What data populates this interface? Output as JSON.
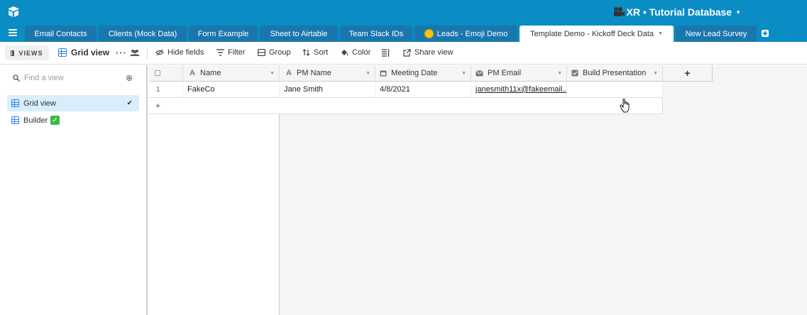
{
  "app": {
    "base_title": "XR • Tutorial Database"
  },
  "tabs": [
    {
      "label": "Email Contacts"
    },
    {
      "label": "Clients (Mock Data)"
    },
    {
      "label": "Form Example"
    },
    {
      "label": "Sheet to Airtable"
    },
    {
      "label": "Team Slack IDs"
    },
    {
      "label": "Leads - Emoji Demo"
    },
    {
      "label": "Template Demo - Kickoff Deck Data"
    },
    {
      "label": "New Lead Survey"
    }
  ],
  "toolbar": {
    "views_label": "VIEWS",
    "current_view": "Grid view",
    "more": "···",
    "hide_fields": "Hide fields",
    "filter": "Filter",
    "group": "Group",
    "sort": "Sort",
    "color": "Color",
    "share_view": "Share view"
  },
  "sidebar": {
    "find_placeholder": "Find a view",
    "views": [
      {
        "label": "Grid view",
        "selected": true,
        "check": "✔"
      },
      {
        "label": "Builder",
        "badge": "✓"
      }
    ]
  },
  "grid": {
    "columns": [
      {
        "label": "Name",
        "type_icon": "A"
      },
      {
        "label": "PM Name",
        "type_icon": "A"
      },
      {
        "label": "Meeting Date",
        "type_icon": "calendar-icon"
      },
      {
        "label": "PM Email",
        "type_icon": "email-icon"
      },
      {
        "label": "Build Presentation",
        "type_icon": "checkbox-icon"
      }
    ],
    "rows": [
      {
        "num": "1",
        "name": "FakeCo",
        "pm_name": "Jane Smith",
        "meeting_date": "4/8/2021",
        "pm_email": "janesmith11x@fakeemail...",
        "build_presentation": ""
      }
    ],
    "add_row": "+",
    "add_column": "+"
  },
  "colors": {
    "header_blue": "#0a8cc4",
    "tab_inactive": "#1a77ad",
    "accent_blue": "#2d7ff9",
    "selected_view_bg": "#d9eefa"
  }
}
